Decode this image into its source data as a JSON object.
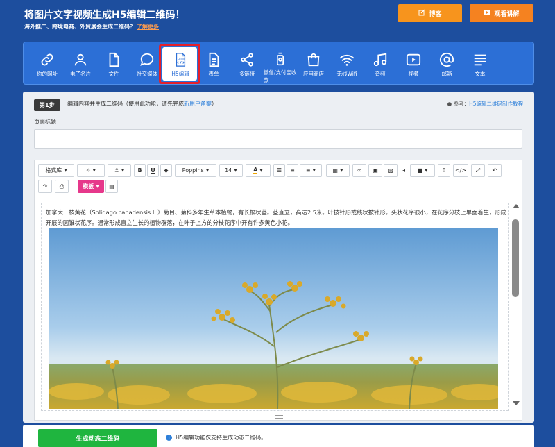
{
  "header": {
    "title": "将图片文字视频生成H5编辑二维码！",
    "subtitle": "海外推广、跨境电商、外贸展会生成二维码？",
    "learn_more": "了解更多",
    "blog_label": "博客",
    "video_label": "观看讲解"
  },
  "nav": {
    "items": [
      {
        "label": "你的网址",
        "icon": "link-icon"
      },
      {
        "label": "电子名片",
        "icon": "person-icon"
      },
      {
        "label": "文件",
        "icon": "file-icon"
      },
      {
        "label": "社交媒体",
        "icon": "chat-bubble-icon"
      },
      {
        "label": "H5编辑",
        "icon": "html5-file-icon",
        "selected": true
      },
      {
        "label": "表单",
        "icon": "form-icon"
      },
      {
        "label": "多链接",
        "icon": "share-icon"
      },
      {
        "label": "微信/支付宝收款",
        "icon": "wechat-pay-icon"
      },
      {
        "label": "应用商店",
        "icon": "shopping-bag-icon"
      },
      {
        "label": "无线Wifi",
        "icon": "wifi-icon"
      },
      {
        "label": "音频",
        "icon": "music-icon"
      },
      {
        "label": "视频",
        "icon": "play-icon"
      },
      {
        "label": "邮箱",
        "icon": "at-icon"
      },
      {
        "label": "文本",
        "icon": "text-lines-icon"
      }
    ],
    "selected_outline_color": "#e4202b"
  },
  "step": {
    "badge": "第1步",
    "text": "编辑内容并生成二维码（使用此功能，请先完成",
    "link": "新用户备案",
    "text_end": "）",
    "ref_prefix": "参考：",
    "ref_link": "H5编辑二维码制作教程"
  },
  "page_title": {
    "label": "页面标题",
    "value": ""
  },
  "toolbar": {
    "style_lib": "格式库",
    "font": "Poppins",
    "size": "14",
    "template": "模板"
  },
  "content": {
    "paragraph": "加拿大一枝黄花（Solidago canadensis L.）菊目、菊科多年生草本植物，有长根状茎。茎直立，高达2.5米。叶披针形或线状披针形。头状花序很小，在花序分枝上单面着生，形成开展的圆锥状花序。通常形成直立生长的植物群落，在叶子上方的分枝花序中开有许多黄色小花。"
  },
  "bottom": {
    "generate_label": "生成动态二维码",
    "note": "H5编辑功能仅支持生成动态二维码。"
  },
  "colors": {
    "background": "#1d4e9e",
    "nav": "#2c6fd6",
    "orange_button": "#f7941d",
    "template_button": "#e6388b",
    "generate_button": "#1fb53f"
  }
}
